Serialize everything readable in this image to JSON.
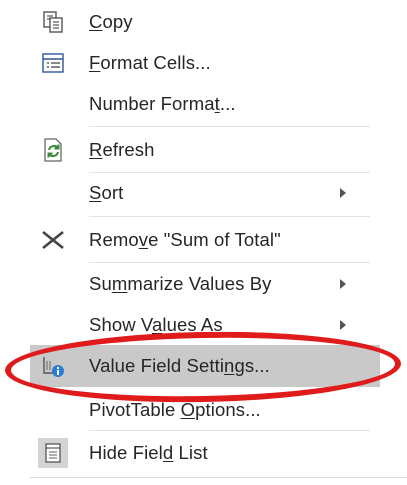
{
  "menu": {
    "items": [
      {
        "pre": "",
        "u": "C",
        "post": "opy",
        "icon": "copy-icon"
      },
      {
        "pre": "",
        "u": "F",
        "post": "ormat Cells...",
        "icon": "format-cells-icon"
      },
      {
        "pre": "Number Forma",
        "u": "t",
        "post": "...",
        "icon": ""
      },
      {
        "pre": "",
        "u": "R",
        "post": "efresh",
        "icon": "refresh-icon"
      },
      {
        "pre": "",
        "u": "S",
        "post": "ort",
        "icon": "",
        "submenu": true
      },
      {
        "pre": "Remo",
        "u": "v",
        "post": "e \"Sum of Total\"",
        "icon": "remove-x-icon"
      },
      {
        "pre": "Su",
        "u": "m",
        "post": "marize Values By",
        "icon": "",
        "submenu": true
      },
      {
        "pre": "Show V",
        "u": "a",
        "post": "lues As",
        "icon": "",
        "submenu": true
      },
      {
        "pre": "Value Field Setti",
        "u": "n",
        "post": "gs...",
        "icon": "value-field-settings-icon",
        "highlighted": true
      },
      {
        "pre": "PivotTable ",
        "u": "O",
        "post": "ptions...",
        "icon": ""
      },
      {
        "pre": "Hide Fiel",
        "u": "d",
        "post": " List",
        "icon": "hide-field-list-icon"
      }
    ]
  },
  "annotation": {
    "color": "#e01b1b"
  }
}
